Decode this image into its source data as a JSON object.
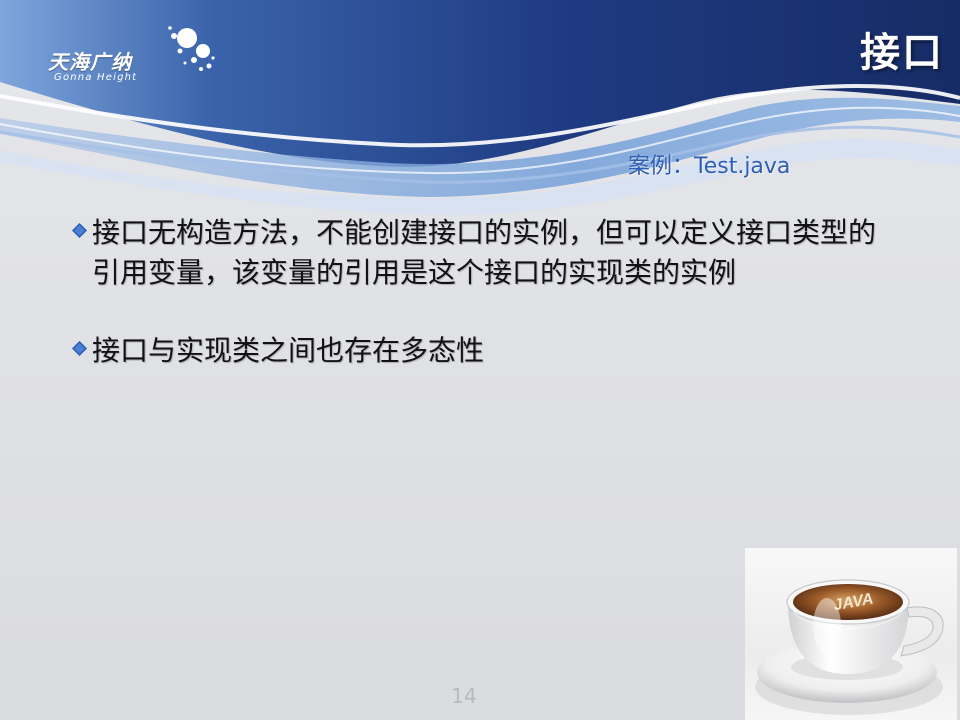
{
  "header": {
    "logo_chinese": "天海广纳",
    "logo_english": "Gonna Height",
    "title": "接口"
  },
  "content": {
    "example": "案例：Test.java",
    "bullets": [
      "接口无构造方法，不能创建接口的实例，但可以定义接口类型的引用变量，该变量的引用是这个接口的实现类的实例",
      "接口与实现类之间也存在多态性"
    ]
  },
  "image": {
    "cup_lettering": "JAVA",
    "description_icon": "coffee-cup-image"
  },
  "footer": {
    "page_number": "14"
  },
  "colors": {
    "header_dark": "#1c3478",
    "header_light": "#6e9bda",
    "example_text": "#2f5eb3",
    "bullet_blue": "#2759b2",
    "body_text": "#121212"
  }
}
